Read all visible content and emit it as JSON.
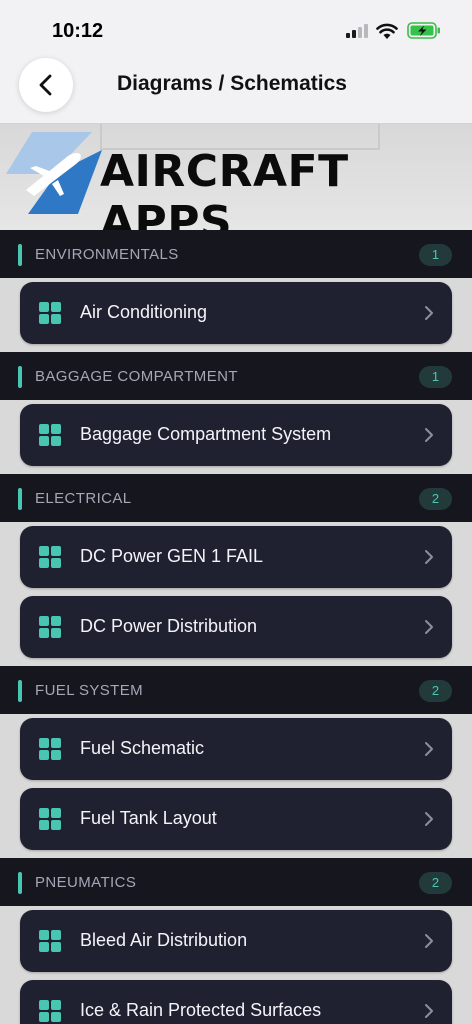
{
  "status_bar": {
    "time": "10:12"
  },
  "nav": {
    "title": "Diagrams / Schematics",
    "back_icon": "chevron-left-icon"
  },
  "banner": {
    "logo_text": "AIRCRAFT APPS",
    "logo_icon": "airplane-logo-icon"
  },
  "colors": {
    "accent": "#49c6b2",
    "header_bg": "#15161e",
    "item_bg": "#1f2130"
  },
  "sections": [
    {
      "title": "ENVIRONMENTALS",
      "count": "1",
      "items": [
        {
          "label": "Air Conditioning"
        }
      ]
    },
    {
      "title": "BAGGAGE COMPARTMENT",
      "count": "1",
      "items": [
        {
          "label": "Baggage Compartment System"
        }
      ]
    },
    {
      "title": "ELECTRICAL",
      "count": "2",
      "items": [
        {
          "label": "DC Power GEN 1 FAIL"
        },
        {
          "label": "DC Power Distribution"
        }
      ]
    },
    {
      "title": "FUEL SYSTEM",
      "count": "2",
      "items": [
        {
          "label": "Fuel Schematic"
        },
        {
          "label": "Fuel Tank Layout"
        }
      ]
    },
    {
      "title": "PNEUMATICS",
      "count": "2",
      "items": [
        {
          "label": "Bleed Air Distribution"
        },
        {
          "label": "Ice & Rain Protected Surfaces"
        }
      ]
    }
  ]
}
